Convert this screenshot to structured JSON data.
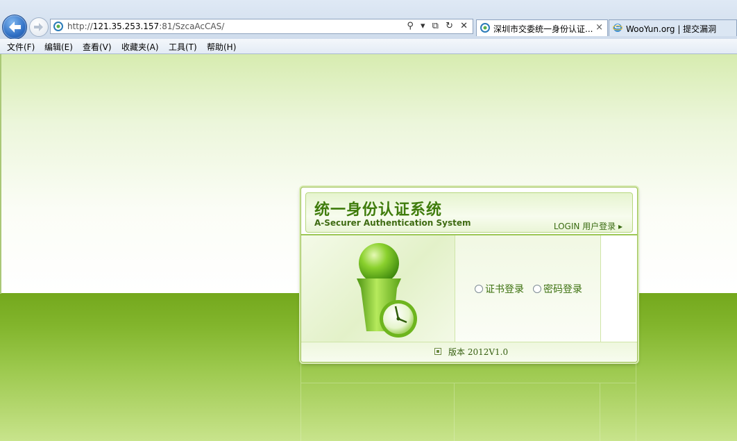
{
  "browser": {
    "url_prefix": "http://",
    "url_host": "121.35.253.157",
    "url_rest": ":81/SzcaAcCAS/",
    "address_tools": "⚲ ▾ ⧉ ↻ ✕",
    "tabs": [
      {
        "label": "深圳市交委统一身份认证...",
        "close": "×"
      },
      {
        "label": "WooYun.org | 提交漏洞"
      }
    ],
    "menu": [
      "文件(F)",
      "编辑(E)",
      "查看(V)",
      "收藏夹(A)",
      "工具(T)",
      "帮助(H)"
    ]
  },
  "login": {
    "title": "统一身份认证系统",
    "subtitle": "A-Securer Authentication System",
    "login_link": "LOGIN 用户登录 ▸",
    "options": [
      {
        "label": "证书登录",
        "selected": false
      },
      {
        "label": "密码登录",
        "selected": false
      }
    ],
    "version_label": "版本 2012V1.0"
  },
  "colors": {
    "brand_green": "#3f7c0c",
    "band_green": "#74a81d"
  },
  "icons": {
    "back": "arrow-left-icon",
    "forward": "arrow-right-icon",
    "site": "ie-globe-icon",
    "version": "document-icon"
  }
}
